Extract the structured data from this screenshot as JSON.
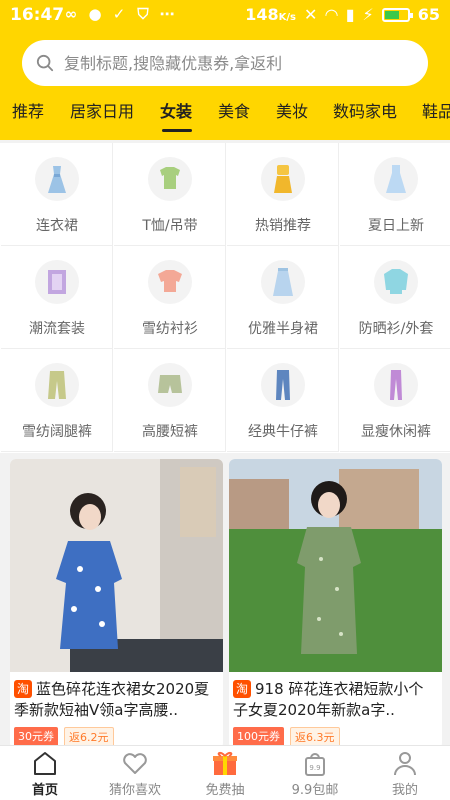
{
  "status_bar": {
    "time": "16:47",
    "net_speed": "148",
    "net_unit": "K/s",
    "battery": "65",
    "battery_fraction": 0.65
  },
  "search": {
    "placeholder": "复制标题,搜隐藏优惠券,拿返利"
  },
  "tabs": [
    {
      "label": "推荐"
    },
    {
      "label": "居家日用"
    },
    {
      "label": "女装",
      "active": true
    },
    {
      "label": "美食"
    },
    {
      "label": "美妆"
    },
    {
      "label": "数码家电"
    },
    {
      "label": "鞋品"
    }
  ],
  "categories": [
    {
      "label": "连衣裙",
      "icon": "dress-icon"
    },
    {
      "label": "T恤/吊带",
      "icon": "tshirt-icon"
    },
    {
      "label": "热销推荐",
      "icon": "hot-outfit-icon"
    },
    {
      "label": "夏日上新",
      "icon": "summer-dress-icon"
    },
    {
      "label": "潮流套装",
      "icon": "suit-icon"
    },
    {
      "label": "雪纺衬衫",
      "icon": "chiffon-shirt-icon"
    },
    {
      "label": "优雅半身裙",
      "icon": "skirt-icon"
    },
    {
      "label": "防晒衫/外套",
      "icon": "sun-jacket-icon"
    },
    {
      "label": "雪纺阔腿裤",
      "icon": "wide-pants-icon"
    },
    {
      "label": "高腰短裤",
      "icon": "shorts-icon"
    },
    {
      "label": "经典牛仔裤",
      "icon": "jeans-icon"
    },
    {
      "label": "显瘦休闲裤",
      "icon": "casual-pants-icon"
    }
  ],
  "products": [
    {
      "source_badge": "淘",
      "title": "蓝色碎花连衣裙女2020夏季新款短袖V领a字高腰..",
      "coupon": "30元券",
      "rebate": "返6.2元"
    },
    {
      "source_badge": "淘",
      "title": "918 碎花连衣裙短款小个子女夏2020年新款a字..",
      "coupon": "100元券",
      "rebate": "返6.3元"
    }
  ],
  "bottom_nav": [
    {
      "label": "首页",
      "icon": "home-icon",
      "active": true
    },
    {
      "label": "猜你喜欢",
      "icon": "heart-icon"
    },
    {
      "label": "免费抽",
      "icon": "gift-icon"
    },
    {
      "label": "9.9包邮",
      "icon": "shopping-bag-icon"
    },
    {
      "label": "我的",
      "icon": "user-icon"
    }
  ],
  "colors": {
    "brand_yellow": "#ffd600",
    "coupon_red": "#ff6c4a",
    "taobao_orange": "#ff5000"
  }
}
